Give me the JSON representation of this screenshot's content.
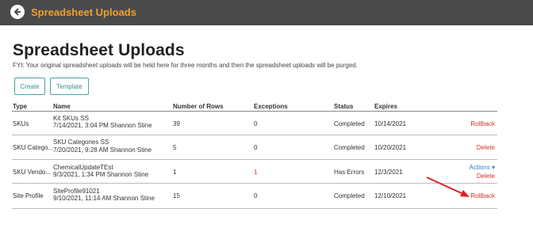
{
  "header": {
    "title": "Spreadsheet Uploads",
    "back_icon": "back-arrow-circle-icon",
    "accent": "#f0a030",
    "bar_color": "#4a4a4a"
  },
  "page": {
    "title": "Spreadsheet Uploads",
    "fyi": "FYI: Your original spreadsheet uploads will be held here for three months and then the spreadsheet uploads will be purged."
  },
  "buttons": {
    "create": "Create",
    "template": "Template"
  },
  "table": {
    "columns": [
      "Type",
      "Name",
      "Number of Rows",
      "Exceptions",
      "Status",
      "Expires"
    ],
    "rows": [
      {
        "type": "SKUs",
        "name": "Kit SKUs SS",
        "meta": "7/14/2021, 3:04 PM Shannon Stine",
        "rows": "39",
        "exceptions": "0",
        "status": "Completed",
        "expires": "10/14/2021",
        "action": "Rollback"
      },
      {
        "type": "SKU Catego...",
        "name": "SKU Categories SS",
        "meta": "7/20/2021, 9:28 AM Shannon Stine",
        "rows": "5",
        "exceptions": "0",
        "status": "Completed",
        "expires": "10/20/2021",
        "action": "Delete"
      },
      {
        "type": "SKU Vendo...",
        "name": "ChemicalUpdateTEst",
        "meta": "9/3/2021, 1:34 PM Shannon Stine",
        "rows": "1",
        "exceptions": "1",
        "status": "Has Errors",
        "expires": "12/3/2021",
        "actions_menu": "Actions ▾",
        "action": "Delete"
      },
      {
        "type": "Site Profile",
        "name": "SiteProfile91021",
        "meta": "9/10/2021, 11:14 AM Shannon Stine",
        "rows": "15",
        "exceptions": "0",
        "status": "Completed",
        "expires": "12/10/2021",
        "action": "Rollback"
      }
    ]
  },
  "annotation": {
    "arrow_color": "#e02020"
  }
}
